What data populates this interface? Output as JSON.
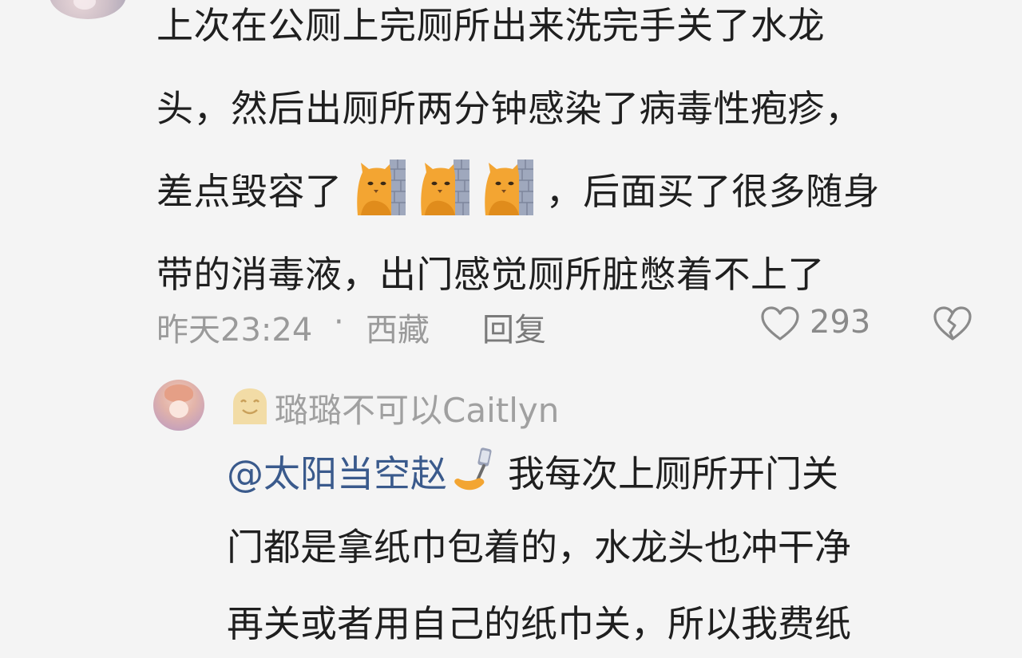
{
  "main_comment": {
    "lines": [
      "上次在公厕上完厕所出来洗完手关了水龙",
      "头，然后出厕所两分钟感染了病毒性疱疹，",
      "差点毁容了",
      "，后面买了很多随身",
      "带的消毒液，出门感觉厕所脏憋着不上了"
    ],
    "emoji_icons": [
      "cat-peek-wall-emoji",
      "cat-peek-wall-emoji",
      "cat-peek-wall-emoji"
    ],
    "time": "昨天23:24",
    "separator": "·",
    "location": "西藏",
    "reply_label": "回复",
    "like_count": "293"
  },
  "sub_reply": {
    "username": "璐璐不可以Caitlyn",
    "mention": "@太阳当空赵",
    "mention_icon": "selfie-stick-emoji",
    "first_line_text": "我每次上厕所开门关",
    "lines": [
      "门都是拿纸巾包着的，水龙头也冲干净",
      "再关或者用自己的纸巾关，所以我费纸"
    ]
  },
  "colors": {
    "background": "#f4f4f4",
    "text": "#1f1f1f",
    "meta": "#9a9a9a",
    "mention": "#3a5a8c",
    "emoji_orange": "#f3a532"
  }
}
